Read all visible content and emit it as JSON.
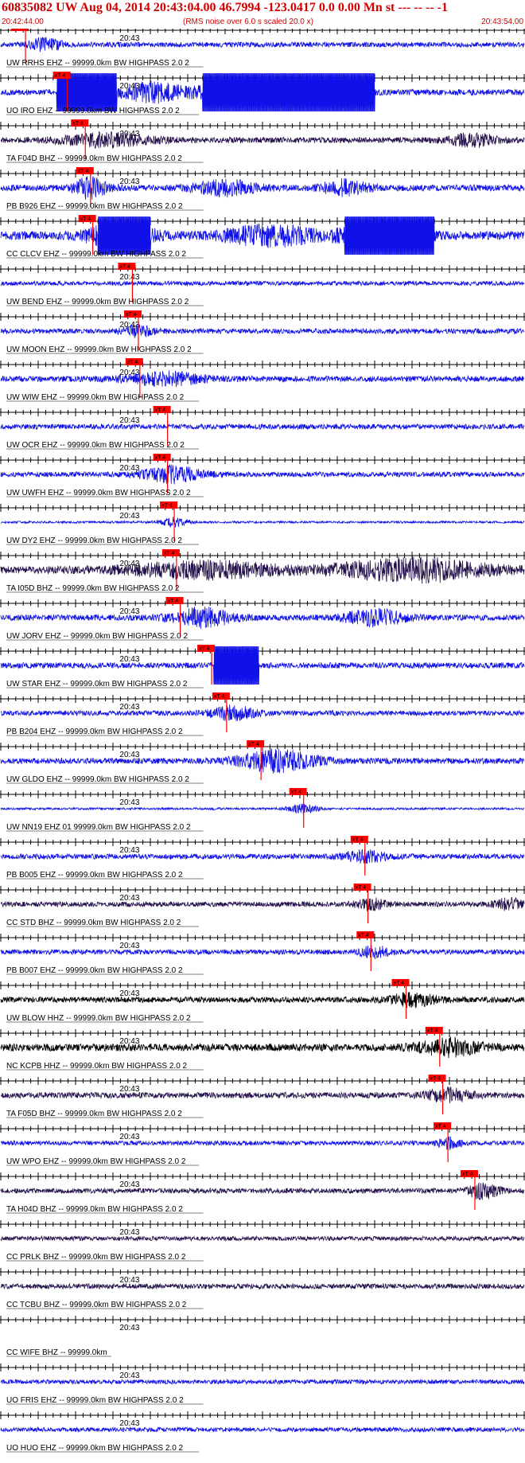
{
  "header": {
    "title": "60835082 UW Aug 04, 2014 20:43:04.00   46.7994 -123.0417  0.0 0.00 Mn st --- -- --   -1",
    "start_time": "20:42:44.00",
    "note": "(RMS noise over 6.0 s scaled 20.0 x)",
    "end_time": "20:43:54.00"
  },
  "chart_data": {
    "type": "seismogram",
    "title": "60835082 UW Aug 04, 2014 20:43:04.00   46.7994 -123.0417  0.0 0.00 Mn st --- -- --   -1",
    "time_window": {
      "start": "20:42:44.00",
      "end": "20:43:54.00",
      "duration_s": 70
    },
    "minute_tick_label": "20:43",
    "minute_tick_offset_s": 16,
    "pick_label": "xT 4",
    "colors": {
      "trace": "#1010e8",
      "trace_dark": "#24104a",
      "trace_black": "#000000",
      "pick": "#ff0000",
      "header_text": "#d00000",
      "axis": "#000000"
    },
    "traces": [
      {
        "label": "UW RRHS EHZ -- 99999.0km BW  HIGHPASS  2.0  2",
        "pick_s": 3.3,
        "color": "#1010e8",
        "amp": 0.35,
        "bursts": [
          [
            6.0,
            2.0,
            2.5
          ]
        ],
        "clip": []
      },
      {
        "label": "UO IRO EHZ -- 99999.0km BW  HIGHPASS  2.0  2",
        "pick_s": 8.9,
        "color": "#1010e8",
        "amp": 0.4,
        "bursts": [
          [
            20,
            4,
            3
          ],
          [
            35,
            8,
            4
          ]
        ],
        "clip": [
          [
            7.5,
            15.5
          ],
          [
            27,
            50
          ],
          [
            43.5,
            50
          ]
        ]
      },
      {
        "label": "TA F04D BHZ -- 99999.0km BW  HIGHPASS  2.0  2",
        "pick_s": 11.3,
        "color": "#24104a",
        "amp": 0.4,
        "bursts": [
          [
            14,
            6,
            2
          ],
          [
            63,
            3,
            2
          ]
        ],
        "clip": []
      },
      {
        "label": "PB B926 EHZ -- 99999.0km BW  HIGHPASS  2.0  2",
        "pick_s": 12.0,
        "color": "#1010e8",
        "amp": 0.45,
        "bursts": [
          [
            12,
            2,
            3
          ],
          [
            30,
            4,
            2
          ],
          [
            46,
            3,
            2
          ]
        ],
        "clip": []
      },
      {
        "label": "CC CLCV EHZ -- 99999.0km BW  HIGHPASS  2.0  2",
        "pick_s": 12.3,
        "color": "#1010e8",
        "amp": 0.6,
        "bursts": [
          [
            16,
            4,
            3
          ],
          [
            36,
            6,
            2
          ],
          [
            51,
            5,
            3
          ]
        ],
        "clip": [
          [
            13,
            20
          ],
          [
            46,
            58
          ]
        ]
      },
      {
        "label": "UW BEND EHZ -- 99999.0km BW  HIGHPASS  2.0  2",
        "pick_s": 17.6,
        "color": "#1010e8",
        "amp": 0.3,
        "bursts": [],
        "clip": []
      },
      {
        "label": "UW MOON EHZ -- 99999.0km BW  HIGHPASS  2.0  2",
        "pick_s": 18.4,
        "color": "#1010e8",
        "amp": 0.35,
        "bursts": [
          [
            18.4,
            2,
            2
          ]
        ],
        "clip": []
      },
      {
        "label": "UW WIW EHZ -- 99999.0km BW  HIGHPASS  2.0  2",
        "pick_s": 18.6,
        "color": "#1010e8",
        "amp": 0.4,
        "bursts": [
          [
            22,
            5,
            2
          ]
        ],
        "clip": []
      },
      {
        "label": "UW OCR EHZ -- 99999.0km BW  HIGHPASS  2.0  2",
        "pick_s": 22.3,
        "color": "#1010e8",
        "amp": 0.35,
        "bursts": [],
        "clip": []
      },
      {
        "label": "UW UWFH EHZ -- 99999.0km BW  HIGHPASS  2.0  2",
        "pick_s": 22.3,
        "color": "#1010e8",
        "amp": 0.35,
        "bursts": [
          [
            23,
            4,
            3
          ]
        ],
        "clip": []
      },
      {
        "label": "UW DY2 EHZ -- 99999.0km BW  HIGHPASS  2.0  2",
        "pick_s": 23.2,
        "color": "#1010e8",
        "amp": 0.15,
        "bursts": [
          [
            23.2,
            2,
            4
          ]
        ],
        "clip": []
      },
      {
        "label": "TA I05D BHZ -- 99999.0km BW  HIGHPASS  2.0  2",
        "pick_s": 23.5,
        "color": "#24104a",
        "amp": 0.5,
        "bursts": [
          [
            27,
            10,
            2
          ],
          [
            55,
            10,
            3
          ]
        ],
        "clip": []
      },
      {
        "label": "UW JORV EHZ -- 99999.0km BW  HIGHPASS  2.0  2",
        "pick_s": 24.0,
        "color": "#1010e8",
        "amp": 0.4,
        "bursts": [
          [
            27,
            4,
            3
          ],
          [
            50,
            4,
            2.5
          ]
        ],
        "clip": []
      },
      {
        "label": "UW STAR EHZ -- 99999.0km BW  HIGHPASS  2.0  2",
        "pick_s": 28.2,
        "color": "#1010e8",
        "amp": 0.4,
        "bursts": [],
        "clip": [
          [
            28.5,
            34.5
          ]
        ]
      },
      {
        "label": "PB B204 EHZ -- 99999.0km BW  HIGHPASS  2.0  2",
        "pick_s": 30.2,
        "color": "#1010e8",
        "amp": 0.35,
        "bursts": [
          [
            31,
            3,
            2.5
          ]
        ],
        "clip": []
      },
      {
        "label": "UW GLDO EHZ -- 99999.0km BW  HIGHPASS  2.0  2",
        "pick_s": 34.8,
        "color": "#1010e8",
        "amp": 0.4,
        "bursts": [
          [
            37,
            5,
            3.5
          ]
        ],
        "clip": []
      },
      {
        "label": "UW NN19 EHZ 01 99999.0km BW  HIGHPASS  2.0  2",
        "pick_s": 40.5,
        "color": "#1010e8",
        "amp": 0.15,
        "bursts": [
          [
            40.5,
            2,
            4
          ]
        ],
        "clip": []
      },
      {
        "label": "PB B005 EHZ -- 99999.0km BW  HIGHPASS  2.0  2",
        "pick_s": 48.7,
        "color": "#1010e8",
        "amp": 0.35,
        "bursts": [
          [
            48.7,
            3,
            2
          ]
        ],
        "clip": []
      },
      {
        "label": "CC STD BHZ -- 99999.0km BW  HIGHPASS  2.0  2",
        "pick_s": 49.1,
        "color": "#24104a",
        "amp": 0.35,
        "bursts": [
          [
            49.5,
            2,
            2
          ],
          [
            68,
            2,
            2
          ]
        ],
        "clip": []
      },
      {
        "label": "PB B007 EHZ -- 99999.0km BW  HIGHPASS  2.0  2",
        "pick_s": 49.5,
        "color": "#1010e8",
        "amp": 0.35,
        "bursts": [
          [
            50,
            2,
            2
          ]
        ],
        "clip": []
      },
      {
        "label": "UW BLOW HHZ -- 99999.0km BW  HIGHPASS  2.0  2",
        "pick_s": 54.2,
        "color": "#000000",
        "amp": 0.4,
        "bursts": [
          [
            55,
            3,
            2
          ]
        ],
        "clip": []
      },
      {
        "label": "NC KCPB HHZ -- 99999.0km BW  HIGHPASS  2.0  2",
        "pick_s": 58.7,
        "color": "#000000",
        "amp": 0.5,
        "bursts": [
          [
            60,
            4,
            2
          ]
        ],
        "clip": []
      },
      {
        "label": "TA F05D BHZ -- 99999.0km BW  HIGHPASS  2.0  2",
        "pick_s": 59.1,
        "color": "#24104a",
        "amp": 0.4,
        "bursts": [
          [
            60,
            3,
            2
          ]
        ],
        "clip": []
      },
      {
        "label": "UW WPO EHZ -- 99999.0km BW  HIGHPASS  2.0  2",
        "pick_s": 59.8,
        "color": "#1010e8",
        "amp": 0.3,
        "bursts": [
          [
            60,
            1.5,
            2.5
          ]
        ],
        "clip": []
      },
      {
        "label": "TA H04D BHZ -- 99999.0km BW  HIGHPASS  2.0  2",
        "pick_s": 63.4,
        "color": "#24104a",
        "amp": 0.35,
        "bursts": [
          [
            64.5,
            2,
            3
          ]
        ],
        "clip": []
      },
      {
        "label": "CC PRLK BHZ -- 99999.0km BW  HIGHPASS  2.0  2",
        "pick_s": null,
        "color": "#24104a",
        "amp": 0.3,
        "bursts": [],
        "clip": []
      },
      {
        "label": "CC TCBU BHZ -- 99999.0km BW  HIGHPASS  2.0  2",
        "pick_s": null,
        "color": "#24104a",
        "amp": 0.35,
        "bursts": [],
        "clip": []
      },
      {
        "label": "CC WIFE BHZ -- 99999.0km",
        "pick_s": null,
        "color": "#1010e8",
        "amp": 0,
        "bursts": [],
        "clip": []
      },
      {
        "label": "UO FRIS EHZ -- 99999.0km BW  HIGHPASS  2.0  2",
        "pick_s": null,
        "color": "#1010e8",
        "amp": 0.3,
        "bursts": [],
        "clip": []
      },
      {
        "label": "UO HUO EHZ -- 99999.0km BW  HIGHPASS  2.0  2",
        "pick_s": null,
        "color": "#1010e8",
        "amp": 0.3,
        "bursts": [],
        "clip": []
      }
    ]
  }
}
